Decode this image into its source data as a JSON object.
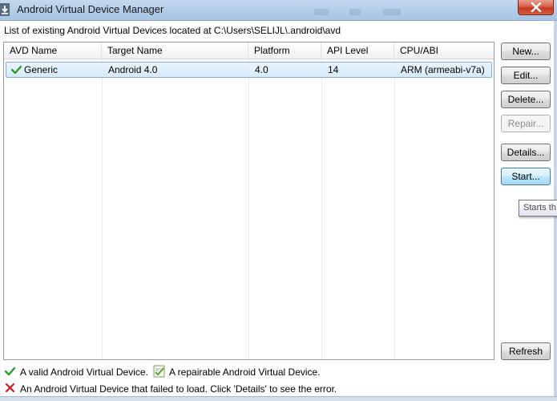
{
  "window": {
    "title": "Android Virtual Device Manager"
  },
  "location_label": "List of existing Android Virtual Devices located at C:\\Users\\SELIJL\\.android\\avd",
  "table": {
    "columns": [
      "AVD Name",
      "Target Name",
      "Platform",
      "API Level",
      "CPU/ABI"
    ],
    "rows": [
      {
        "status_icon": "valid-check-icon",
        "avd_name": "Generic",
        "target_name": "Android 4.0",
        "platform": "4.0",
        "api_level": "14",
        "cpu_abi": "ARM (armeabi-v7a)"
      }
    ]
  },
  "buttons": {
    "new": "New...",
    "edit": "Edit...",
    "delete": "Delete...",
    "repair": "Repair...",
    "details": "Details...",
    "start": "Start...",
    "refresh": "Refresh"
  },
  "tooltip": "Starts th",
  "legend": {
    "valid": "A valid Android Virtual Device.",
    "repairable": "A repairable Android Virtual Device.",
    "failed": "An Android Virtual Device that failed to load. Click 'Details' to see the error."
  },
  "colors": {
    "valid_green": "#2d9a2d",
    "failed_red": "#d21a1a",
    "selection_border": "#84acdd",
    "focus_blue": "#3c7fb1"
  }
}
